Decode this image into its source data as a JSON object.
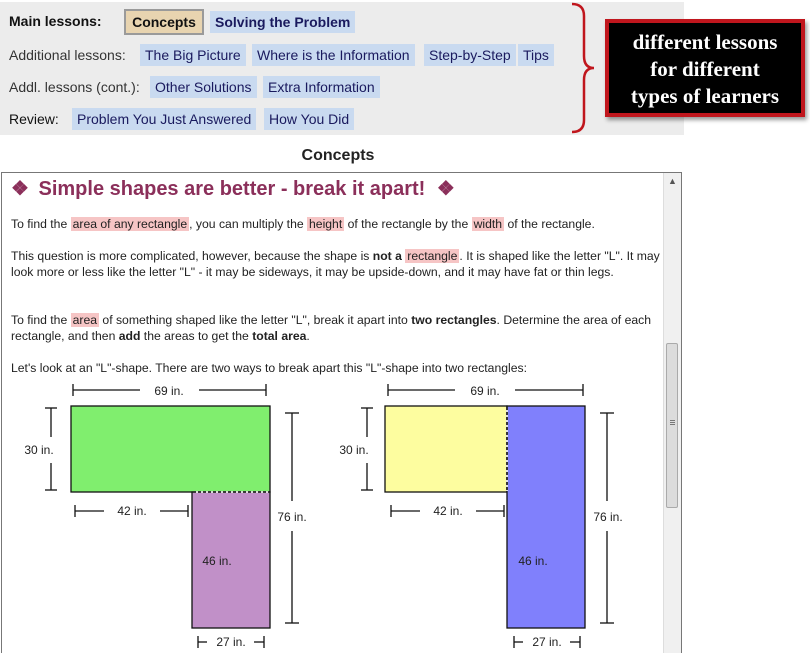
{
  "nav": {
    "rows": [
      {
        "label": "Main lessons:",
        "buttons": [
          "Concepts",
          "Solving the Problem"
        ]
      },
      {
        "label": "Additional lessons:",
        "buttons": [
          "The Big Picture",
          "Where is the Information",
          "Step-by-Step",
          "Tips"
        ]
      },
      {
        "label": "Addl. lessons (cont.):",
        "buttons": [
          "Other Solutions",
          "Extra Information"
        ]
      },
      {
        "label": "Review:",
        "buttons": [
          "Problem You Just Answered",
          "How You Did"
        ]
      }
    ],
    "active": "Concepts"
  },
  "callout": {
    "lines": [
      "different lessons",
      "for different",
      "types of learners"
    ],
    "border_color": "#c0161d"
  },
  "section_heading": "Concepts",
  "lesson": {
    "title": "Simple shapes are better - break it apart!",
    "bullet_icon": "diamond-bullet-icon",
    "p1": {
      "a": "To find the ",
      "h1": "area of any rectangle",
      "b": ", you can multiply the ",
      "h2": "height",
      "c": " of the rectangle by the ",
      "h3": "width",
      "d": " of the rectangle."
    },
    "p2": {
      "a": "This question is more complicated, however, because the shape is ",
      "bold": "not a",
      "h1": "rectangle",
      "b": ". It is shaped like the letter \"L\". It may look more or less like the letter \"L\" - it may be sideways, it may be upside-down, and it may have fat or thin legs."
    },
    "p3": {
      "a": "To find the ",
      "h1": "area",
      "b": " of something shaped like the letter \"L\", break it apart into ",
      "bold1": "two rectangles",
      "c": ". Determine the area of each rectangle, and then ",
      "bold2": "add",
      "d": " the areas to get the ",
      "bold3": "total area",
      "e": "."
    },
    "p4": "Let's look at an \"L\"-shape. There are two ways to break apart this \"L\"-shape into two rectangles:"
  },
  "diagrams": [
    {
      "top_color": "#80ee6e",
      "bottom_color": "#c190c8",
      "split": "horizontal"
    },
    {
      "top_color": "#fdfd9f",
      "bottom_color": "#8080fc",
      "split": "vertical"
    }
  ],
  "dimensions": {
    "top_width": "69 in.",
    "top_height": "30 in.",
    "left_part": "42 in.",
    "total_height": "76 in.",
    "leg_height": "46 in.",
    "leg_width": "27 in."
  },
  "colors": {
    "highlight": "#f6c5c5",
    "title": "#8b2f5a",
    "nav_button": "#c9daf0",
    "active_button": "#e8d4b0"
  }
}
